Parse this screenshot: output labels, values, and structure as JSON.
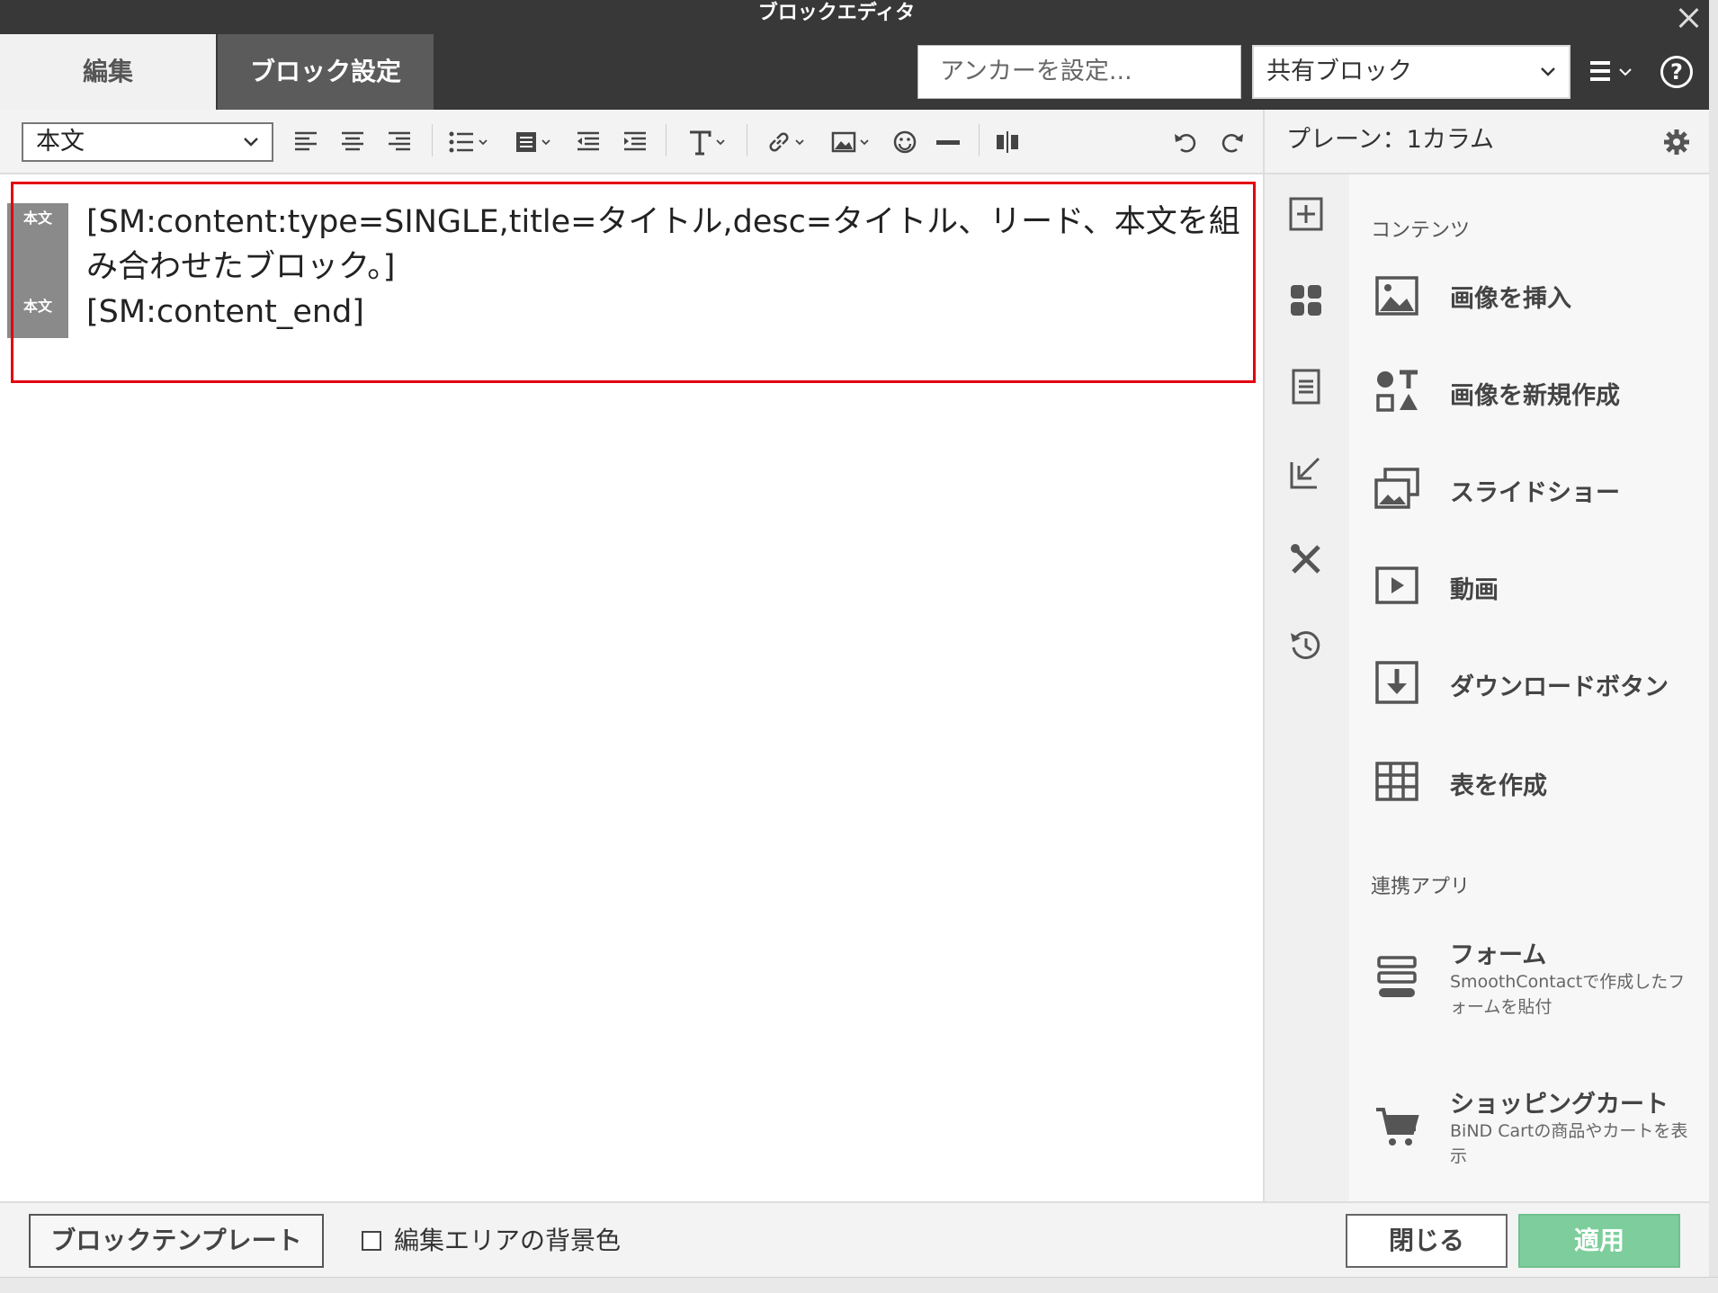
{
  "window": {
    "title": "ブロックエディタ"
  },
  "tabs": {
    "edit": "編集",
    "block_settings": "ブロック設定"
  },
  "header": {
    "anchor_placeholder": "アンカーを設定...",
    "shared_block": "共有ブロック"
  },
  "toolbar": {
    "style_select": "本文"
  },
  "panel": {
    "title": "プレーン：1カラム"
  },
  "editor": {
    "tags": [
      "本文",
      "本文"
    ],
    "lines": [
      "[SM:content:type=SINGLE,title=タイトル,desc=タイトル、リード、本文を組み合わせたブロック。]",
      "[SM:content_end]"
    ]
  },
  "sidebar": {
    "contents_label": "コンテンツ",
    "contents": [
      {
        "label": "画像を挿入",
        "icon": "image-icon"
      },
      {
        "label": "画像を新規作成",
        "icon": "shapes-icon"
      },
      {
        "label": "スライドショー",
        "icon": "slideshow-icon"
      },
      {
        "label": "動画",
        "icon": "video-icon"
      },
      {
        "label": "ダウンロードボタン",
        "icon": "download-icon"
      },
      {
        "label": "表を作成",
        "icon": "table-icon"
      }
    ],
    "apps_label": "連携アプリ",
    "apps": [
      {
        "label": "フォーム",
        "desc": "SmoothContactで作成したフォームを貼付",
        "icon": "form-icon"
      },
      {
        "label": "ショッピングカート",
        "desc": "BiND Cartの商品やカートを表示",
        "icon": "cart-icon"
      }
    ]
  },
  "footer": {
    "template_button": "ブロックテンプレート",
    "bg_color_label": "編集エリアの背景色",
    "close_button": "閉じる",
    "apply_button": "適用"
  },
  "colors": {
    "header_bg": "#383838",
    "active_tab": "#5b5b5b",
    "apply": "#7dce9c",
    "highlight": "#e2000f"
  }
}
